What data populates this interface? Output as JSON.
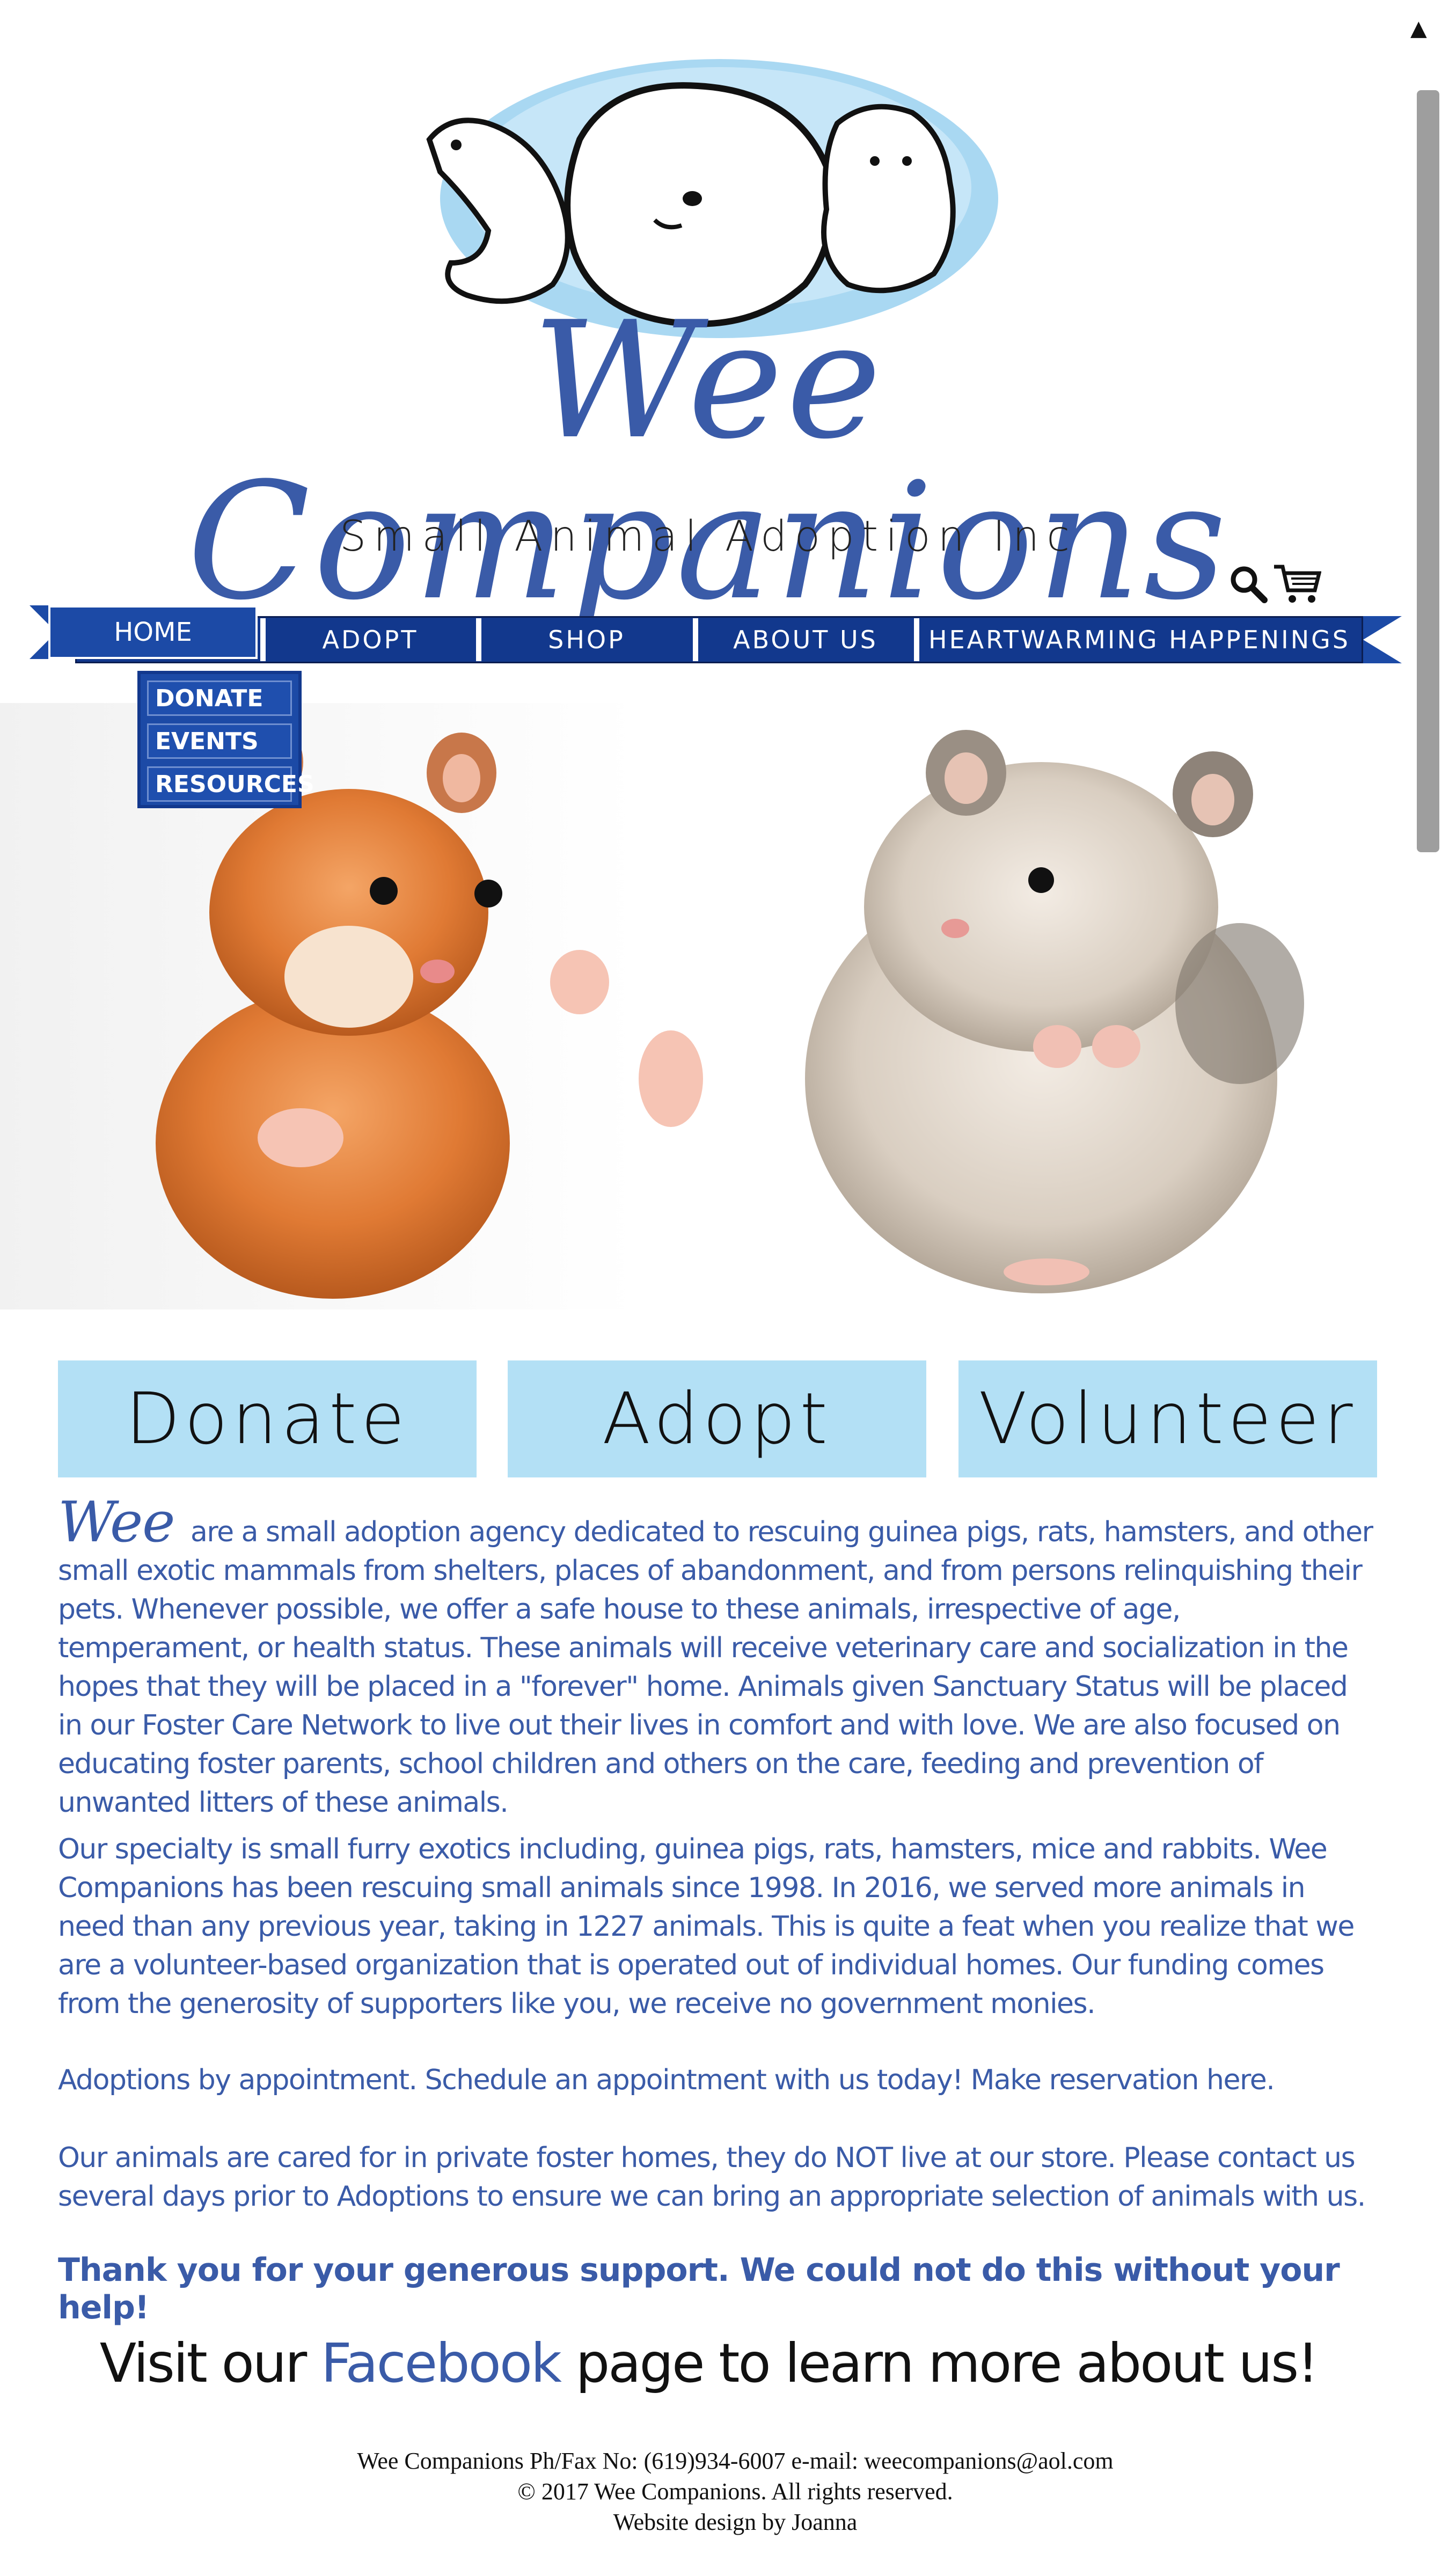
{
  "site": {
    "title": "Wee Companions",
    "subtitle": "Small Animal Adoption Inc"
  },
  "utility": {
    "search_icon": "search-icon",
    "cart_icon": "cart-icon"
  },
  "nav": {
    "home": "HOME",
    "items": [
      "ADOPT",
      "SHOP",
      "ABOUT US",
      "HEARTWARMING HAPPENINGS"
    ],
    "dropdown": [
      "DONATE",
      "EVENTS",
      "RESOURCES"
    ]
  },
  "cta": {
    "donate": "Donate",
    "adopt": "Adopt",
    "volunteer": "Volunteer"
  },
  "body": {
    "we": "Wee",
    "p1": "are a small adoption agency dedicated to rescuing guinea pigs, rats, hamsters, and other small exotic mammals from shelters, places of abandonment, and from persons relinquishing their pets. Whenever possible, we offer a safe house to these animals, irrespective of age, temperament, or health status. These animals will receive veterinary care and socialization in the hopes that they will be placed in a \"forever\" home. Animals given Sanctuary Status will be placed in our Foster Care Network to live out their lives in comfort and with love. We are also focused on educating foster parents, school children and others on the care, feeding and prevention of unwanted litters of these animals.",
    "p2": "Our specialty is small furry exotics including, guinea pigs, rats, hamsters, mice and rabbits. Wee Companions has been rescuing small animals since 1998. In 2016, we served more animals in need than any previous year, taking in 1227 animals. This is quite a feat when you realize that we are a volunteer-based organization that is operated out of individual homes. Our funding comes from the generosity of supporters like you, we receive no government monies.",
    "p3": "Adoptions by appointment. Schedule an appointment with us today! Make reservation here.",
    "p4": "Our animals are cared for in private foster homes, they do NOT live at our store.  Please contact us several days prior to Adoptions to ensure we can bring an appropriate selection of animals with us.",
    "thanks": "Thank you for your generous support.  We could not do this without your help!"
  },
  "visit": {
    "pre": "Visit our ",
    "link": "Facebook",
    "post": " page to learn more about us!"
  },
  "footer": {
    "contact": "Wee Companions Ph/Fax No: (619)934-6007 e-mail: weecompanions@aol.com",
    "copyright": "© 2017 Wee Companions. All rights reserved.",
    "credit": "Website design by Joanna"
  },
  "colors": {
    "brand_blue": "#3a5ba8",
    "nav_blue": "#12388d",
    "cta_bg": "#b3e0f5"
  }
}
